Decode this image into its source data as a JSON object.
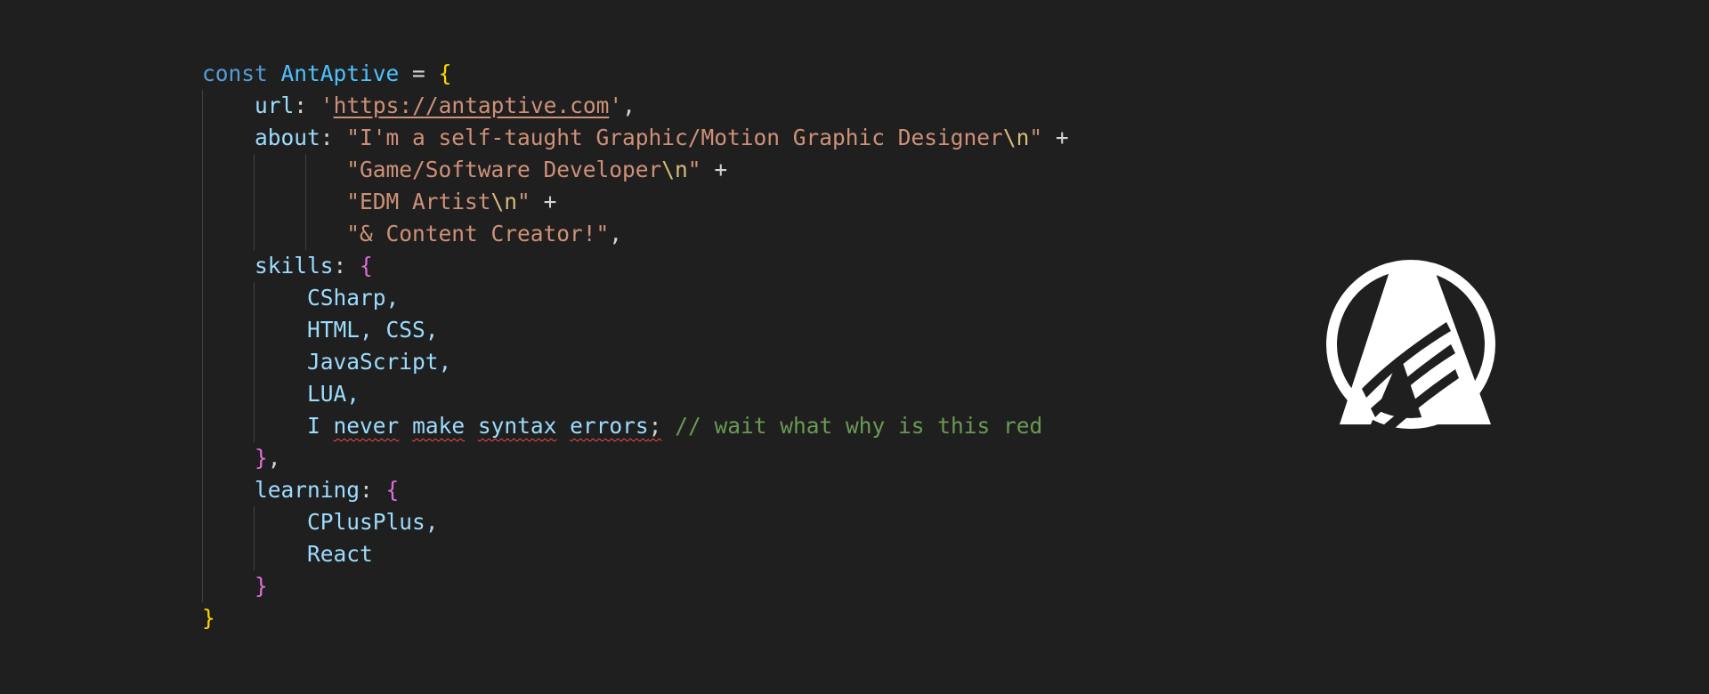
{
  "code": {
    "line1": {
      "keyword": "const",
      "name": "AntAptive",
      "eq": " = ",
      "open": "{"
    },
    "line2": {
      "prop": "url",
      "colon": ": ",
      "q1": "'",
      "url": "https://antaptive.com",
      "q2": "'",
      "comma": ","
    },
    "line3": {
      "prop": "about",
      "colon": ": ",
      "str": "\"I'm a self-taught Graphic/Motion Graphic Designer",
      "esc": "\\n",
      "end": "\"",
      "plus": " +"
    },
    "line4": {
      "str": "\"Game/Software Developer",
      "esc": "\\n",
      "end": "\"",
      "plus": " +"
    },
    "line5": {
      "str": "\"EDM Artist",
      "esc": "\\n",
      "end": "\"",
      "plus": " +"
    },
    "line6": {
      "str": "\"& Content Creator!\"",
      "comma": ","
    },
    "line7": {
      "prop": "skills",
      "colon": ": ",
      "open": "{"
    },
    "skills": [
      "CSharp,",
      "HTML, CSS,",
      "JavaScript,",
      "LUA,"
    ],
    "line12": {
      "w1": "I",
      "w2": "never",
      "w3": "make",
      "w4": "syntax",
      "w5": "errors",
      "semi": ";",
      "comment": "// wait what why is this red"
    },
    "line13": {
      "close": "}",
      "comma": ","
    },
    "line14": {
      "prop": "learning",
      "colon": ": ",
      "open": "{"
    },
    "learning": [
      "CPlusPlus,",
      "React"
    ],
    "line17": {
      "close": "}"
    },
    "line18": {
      "close": "}"
    }
  },
  "logo": {
    "icon": "antaptive-logo-icon",
    "color": "#ffffff"
  },
  "colors": {
    "background": "#1f1f1f",
    "keyword": "#569cd6",
    "property": "#9cdcfe",
    "string": "#ce9178",
    "comment": "#6a9955",
    "bracket_level1": "#ffd700",
    "bracket_level2": "#da70d6",
    "error_squiggle": "#f14c4c"
  }
}
